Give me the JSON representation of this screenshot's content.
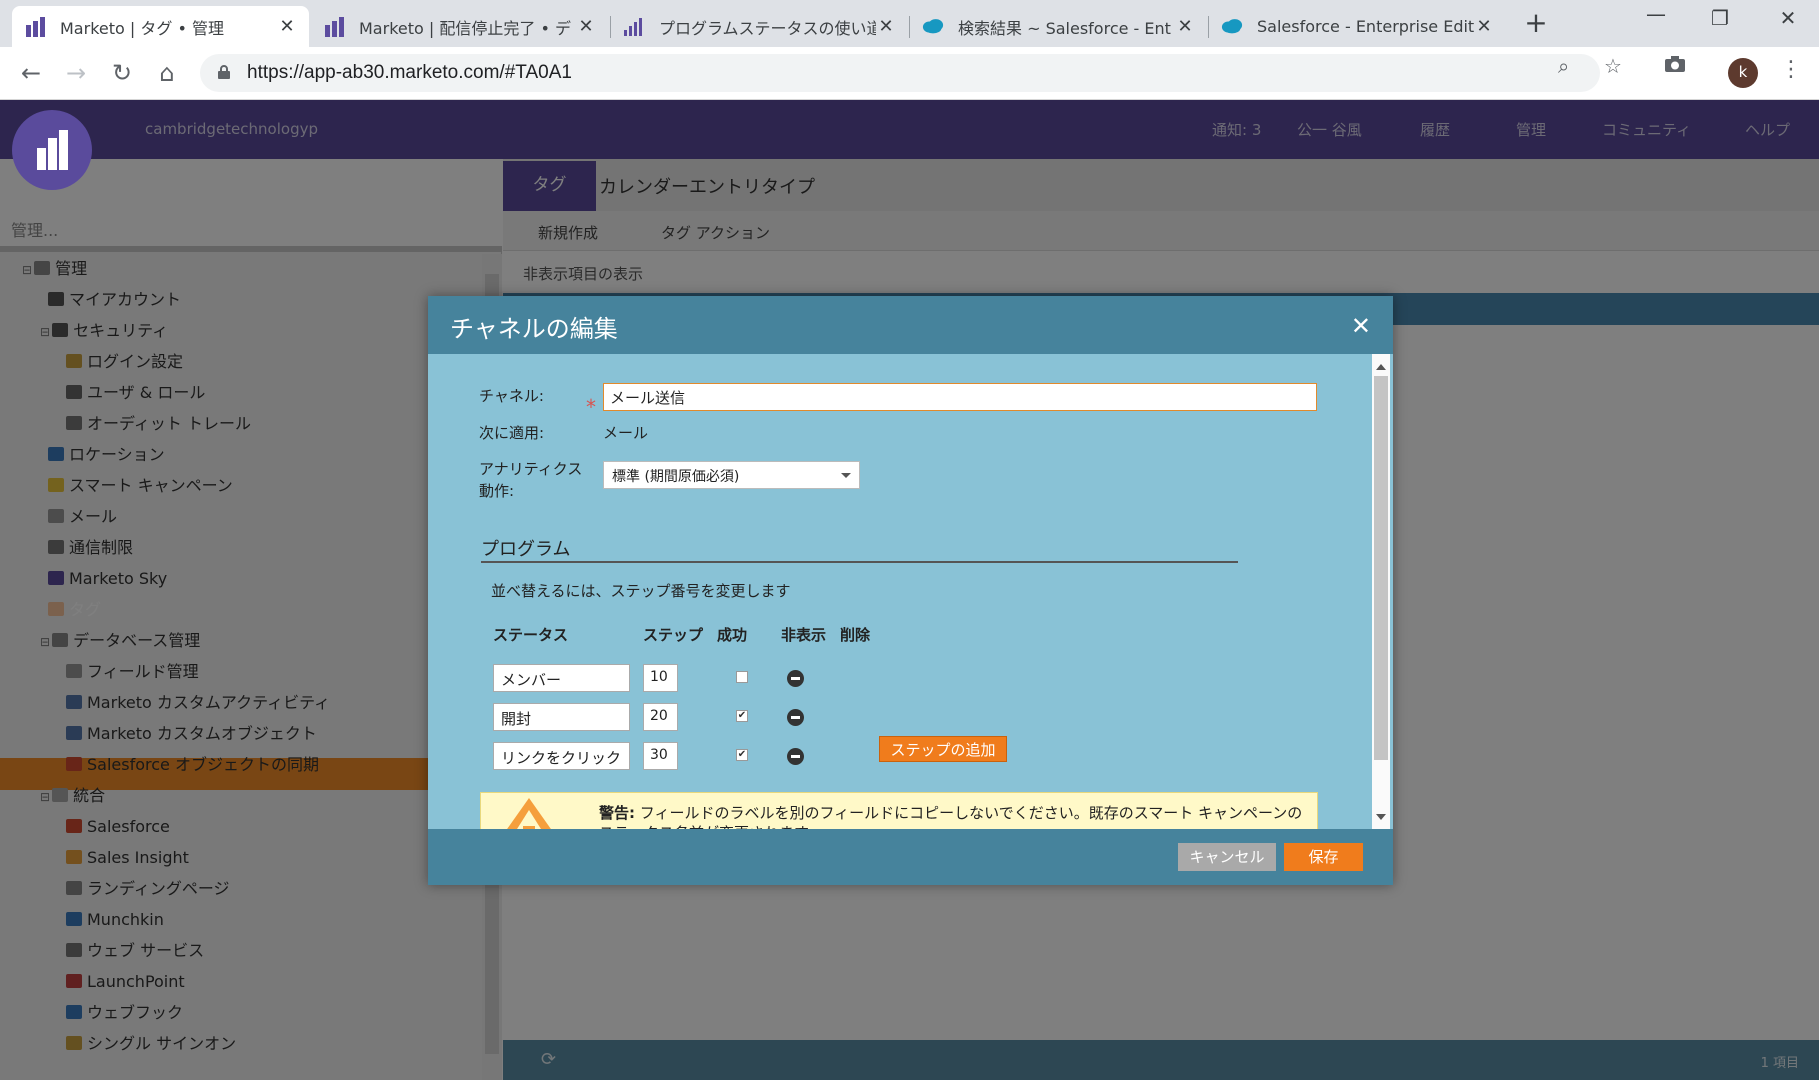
{
  "browser": {
    "tabs": [
      {
        "title": "Marketo | タグ • 管理",
        "icon": "marketo-logo"
      },
      {
        "title": "Marketo | 配信停止完了 • デ",
        "icon": "marketo-logo"
      },
      {
        "title": "プログラムステータスの使い道に",
        "icon": "chart-bars"
      },
      {
        "title": "検索結果 ~ Salesforce - Ent",
        "icon": "salesforce-cloud"
      },
      {
        "title": "Salesforce - Enterprise Editi",
        "icon": "salesforce-cloud"
      }
    ],
    "close_glyph": "✕",
    "new_tab_glyph": "+",
    "url": "https://app-ab30.marketo.com/#TA0A1",
    "profile_initial": "k"
  },
  "app": {
    "subscription_name": "cambridgetechnologyp",
    "topnav": [
      {
        "label": "通知: 3",
        "icon": "bell"
      },
      {
        "label": "公一 谷風",
        "icon": "user"
      },
      {
        "label": "履歴",
        "icon": "history"
      },
      {
        "label": "管理",
        "icon": "gear"
      },
      {
        "label": "コミュニティ",
        "icon": "community"
      },
      {
        "label": "ヘルプ",
        "icon": "help"
      }
    ],
    "search_placeholder": "管理...",
    "tree": [
      {
        "label": "管理",
        "icon": "gear",
        "level": 0,
        "expander": true
      },
      {
        "label": "マイアカウント",
        "icon": "user",
        "level": 1
      },
      {
        "label": "セキュリティ",
        "icon": "lock",
        "level": 1,
        "expander": true
      },
      {
        "label": "ログイン設定",
        "icon": "key",
        "level": 2
      },
      {
        "label": "ユーザ & ロール",
        "icon": "users",
        "level": 2
      },
      {
        "label": "オーディット トレール",
        "icon": "trail",
        "level": 2
      },
      {
        "label": "ロケーション",
        "icon": "globe",
        "level": 1
      },
      {
        "label": "スマート キャンペーン",
        "icon": "bulb",
        "level": 1
      },
      {
        "label": "メール",
        "icon": "mail",
        "level": 1
      },
      {
        "label": "通信制限",
        "icon": "limit",
        "level": 1
      },
      {
        "label": "Marketo Sky",
        "icon": "sky",
        "level": 1
      },
      {
        "label": "タグ",
        "icon": "tag",
        "level": 1,
        "selected": true
      },
      {
        "label": "データベース管理",
        "icon": "database",
        "level": 1,
        "expander": true
      },
      {
        "label": "フィールド管理",
        "icon": "field",
        "level": 2
      },
      {
        "label": "Marketo カスタムアクティビティ",
        "icon": "activity",
        "level": 2
      },
      {
        "label": "Marketo カスタムオブジェクト",
        "icon": "object",
        "level": 2
      },
      {
        "label": "Salesforce オブジェクトの同期",
        "icon": "sync",
        "level": 2
      },
      {
        "label": "統合",
        "icon": "cloud",
        "level": 1,
        "expander": true
      },
      {
        "label": "Salesforce",
        "icon": "salesforce",
        "level": 2
      },
      {
        "label": "Sales Insight",
        "icon": "insight",
        "level": 2
      },
      {
        "label": "ランディングページ",
        "icon": "page",
        "level": 2
      },
      {
        "label": "Munchkin",
        "icon": "munchkin",
        "level": 2
      },
      {
        "label": "ウェブ サービス",
        "icon": "webservice",
        "level": 2
      },
      {
        "label": "LaunchPoint",
        "icon": "rocket",
        "level": 2
      },
      {
        "label": "ウェブフック",
        "icon": "webhook",
        "level": 2
      },
      {
        "label": "シングル サインオン",
        "icon": "sso",
        "level": 2
      }
    ],
    "main_tabs": {
      "active": "タグ",
      "other": "カレンダーエントリタイプ"
    },
    "toolbar": {
      "new": "新規作成",
      "tag_actions": "タグ アクション"
    },
    "show_hidden": "非表示項目の表示",
    "item_count": "1 項目"
  },
  "dialog": {
    "title": "チャネルの編集",
    "close_glyph": "✕",
    "channel_label": "チャネル:",
    "required_mark": "*",
    "channel_value": "メール送信",
    "applies_label": "次に適用:",
    "applies_value": "メール",
    "analytics_label_1": "アナリティクス",
    "analytics_label_2": "動作:",
    "analytics_value": "標準 (期間原価必須)",
    "program_section": "プログラム",
    "reorder_hint": "並べ替えるには、ステップ番号を変更します",
    "columns": {
      "status": "ステータス",
      "step": "ステップ",
      "success": "成功",
      "hidden": "非表示",
      "delete": "削除"
    },
    "rows": [
      {
        "status": "メンバー",
        "step": "10",
        "success": false
      },
      {
        "status": "開封",
        "step": "20",
        "success": true
      },
      {
        "status": "リンクをクリック",
        "step": "30",
        "success": true
      }
    ],
    "checkmark_glyph": "✔",
    "add_step": "ステップの追加",
    "warning_label": "警告:",
    "warning_text": " フィールドのラベルを別のフィールドにコピーしないでください。既存のスマート キャンペーンのステータス名前が変更されます",
    "cancel": "キャンセル",
    "save": "保存"
  }
}
